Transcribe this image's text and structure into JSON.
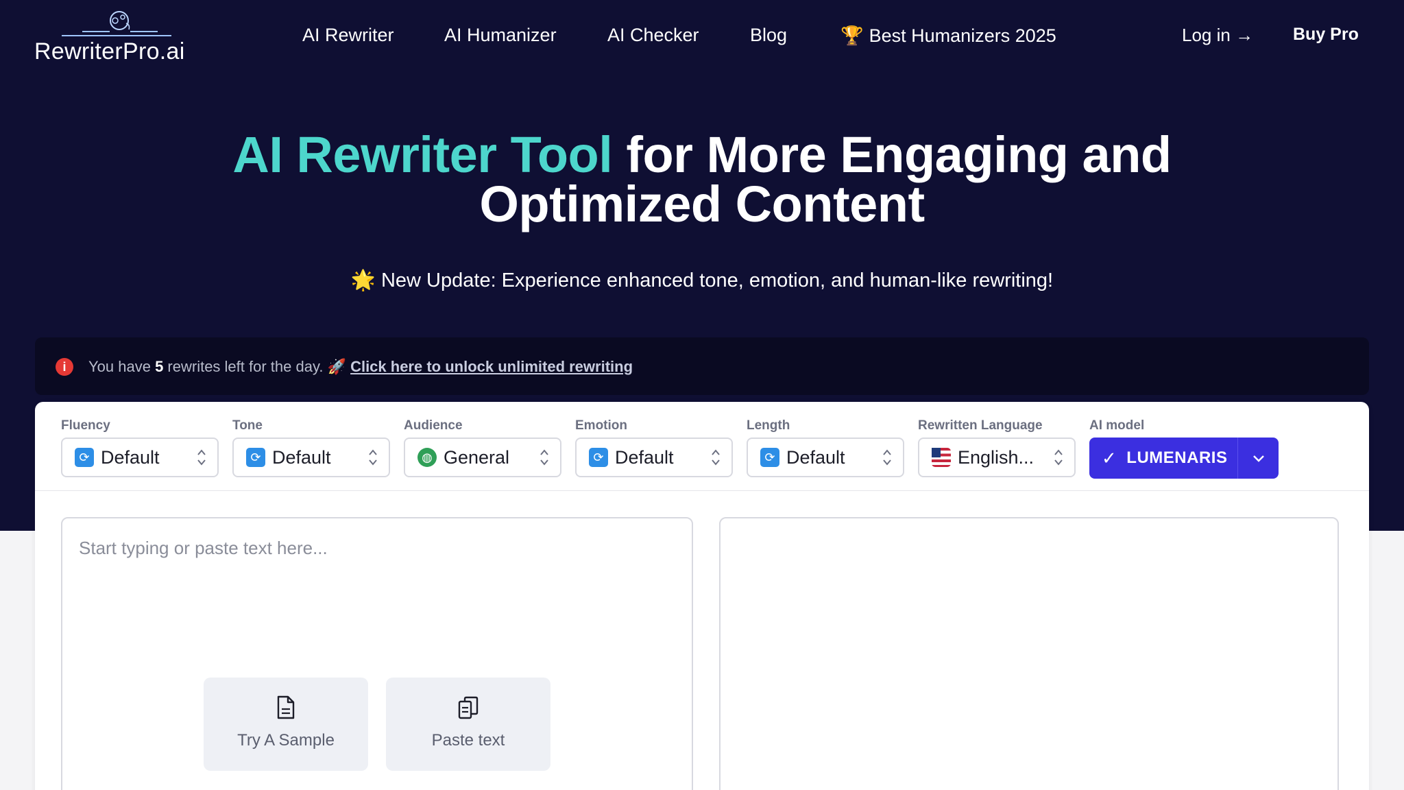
{
  "brand": {
    "logo_text": "RewriterPro.ai"
  },
  "nav": {
    "links": [
      {
        "label": "AI Rewriter"
      },
      {
        "label": "AI Humanizer"
      },
      {
        "label": "AI Checker"
      },
      {
        "label": "Blog"
      },
      {
        "label": "Best Humanizers 2025"
      }
    ],
    "login": "Log in →",
    "buy_pro": "Buy Pro"
  },
  "hero": {
    "headline_accent": "AI Rewriter Tool",
    "headline_rest_1": " for More Engaging and",
    "headline_rest_2": "Optimized Content",
    "subline_icon": "🌟",
    "subline": "New Update: Experience enhanced tone, emotion, and human-like rewriting!"
  },
  "notice": {
    "prefix": "You have ",
    "count": "5",
    "suffix": " rewrites left for the day. 🚀 ",
    "link": "Click here to unlock unlimited rewriting"
  },
  "options": {
    "fluency": {
      "label": "Fluency",
      "value": "Default"
    },
    "tone": {
      "label": "Tone",
      "value": "Default"
    },
    "audience": {
      "label": "Audience",
      "value": "General"
    },
    "emotion": {
      "label": "Emotion",
      "value": "Default"
    },
    "length": {
      "label": "Length",
      "value": "Default"
    },
    "language": {
      "label": "Rewritten Language",
      "value": "English..."
    },
    "ai_model": {
      "label": "AI model",
      "value": "LUMENARIS"
    }
  },
  "editor": {
    "placeholder": "Start typing or paste text here...",
    "try_sample": "Try A Sample",
    "paste_text": "Paste text"
  },
  "colors": {
    "hero_bg": "#0f0f33",
    "accent": "#4dd6cc",
    "ai_button": "#3b2fe0",
    "info_icon": "#e53935"
  }
}
